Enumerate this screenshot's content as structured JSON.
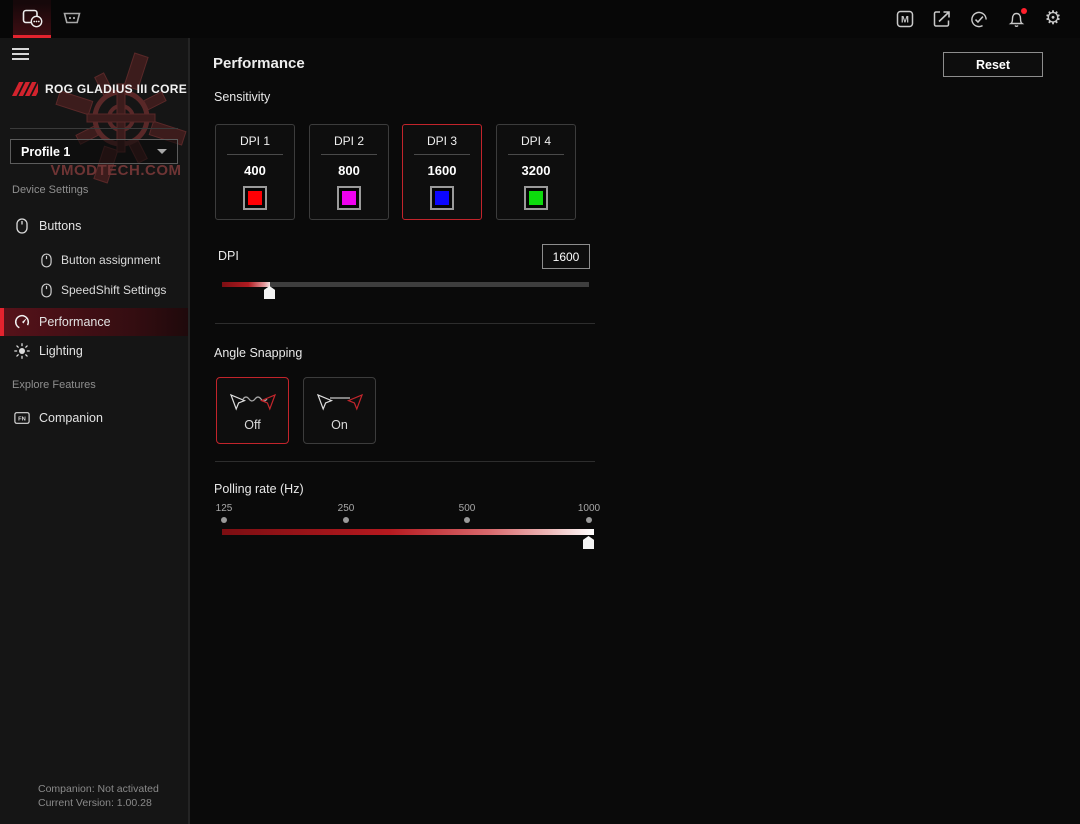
{
  "topbar": {
    "tabs": [
      {
        "name": "mouse-device",
        "active": true
      },
      {
        "name": "dock-device",
        "active": false
      }
    ],
    "right_icon_names": [
      "rog-m-badge-icon",
      "popout-icon",
      "update-check-icon",
      "notifications-bell-icon",
      "settings-gear-icon"
    ],
    "m_icon_letter": "M",
    "gear_glyph": "⚙",
    "notification_dot": true
  },
  "sidebar": {
    "device_name": "ROG GLADIUS III CORE",
    "profile_selected": "Profile 1",
    "sections": [
      {
        "label": "Device Settings"
      },
      {
        "label": "Explore Features"
      }
    ],
    "items": {
      "buttons": "Buttons",
      "button_assignment": "Button assignment",
      "speedshift": "SpeedShift Settings",
      "performance": "Performance",
      "lighting": "Lighting",
      "companion": "Companion"
    },
    "active_item": "Performance",
    "fn_icon_label": "FN",
    "footer_line1": "Companion:  Not activated",
    "footer_line2": "Current Version: 1.00.28",
    "watermark": "VMODTECH.COM"
  },
  "main": {
    "title": "Performance",
    "reset_label": "Reset",
    "sensitivity_label": "Sensitivity",
    "dpi_presets": [
      {
        "label": "DPI 1",
        "value": "400",
        "color": "#ff0004",
        "selected": false
      },
      {
        "label": "DPI 2",
        "value": "800",
        "color": "#ef00ef",
        "selected": false
      },
      {
        "label": "DPI 3",
        "value": "1600",
        "color": "#0b06ff",
        "selected": true
      },
      {
        "label": "DPI 4",
        "value": "3200",
        "color": "#0ddb0d",
        "selected": false
      }
    ],
    "dpi_slider": {
      "label": "DPI",
      "value": "1600",
      "fill_percent": 13
    },
    "angle_snapping": {
      "label": "Angle Snapping",
      "options": [
        {
          "label": "Off",
          "selected": true
        },
        {
          "label": "On",
          "selected": false
        }
      ]
    },
    "polling": {
      "label": "Polling rate (Hz)",
      "ticks": [
        "125",
        "250",
        "500",
        "1000"
      ],
      "selected_value": "1000",
      "fill_percent": 100
    }
  },
  "colors": {
    "accent_red": "#e3232e",
    "selected_border": "#c2242b"
  }
}
